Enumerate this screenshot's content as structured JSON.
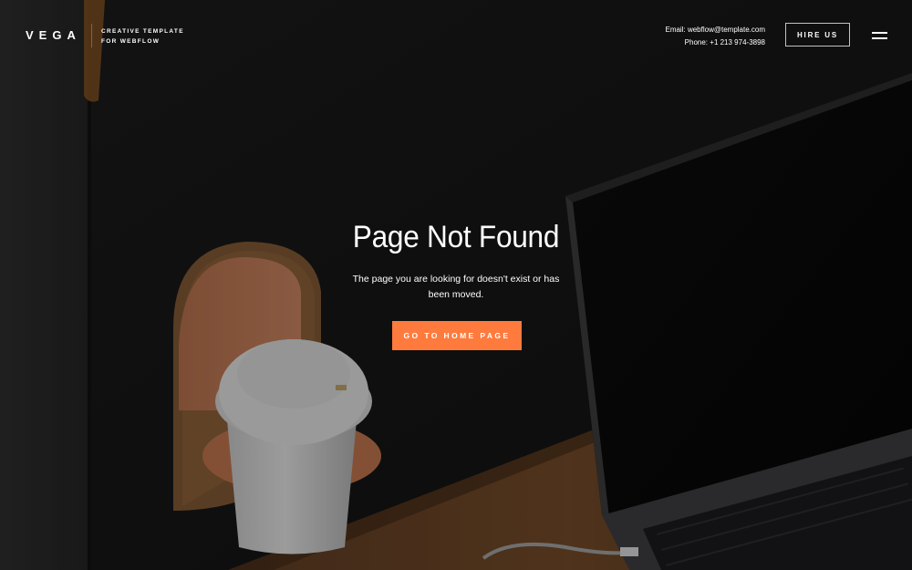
{
  "header": {
    "logo": "VEGA",
    "tagline_line1": "CREATIVE TEMPLATE",
    "tagline_line2": "FOR WEBFLOW",
    "email_label": "Email:",
    "email_value": "webflow@template.com",
    "phone_label": "Phone:",
    "phone_value": "+1 213 974-3898",
    "hire_button": "HIRE US",
    "menu_icon": "hamburger-menu-icon"
  },
  "main": {
    "title": "Page Not Found",
    "message": "The page you are looking for doesn't exist or has been moved.",
    "home_button": "GO TO HOME PAGE"
  },
  "colors": {
    "accent": "#ff7a3d",
    "background": "#151515",
    "text": "#ffffff"
  }
}
